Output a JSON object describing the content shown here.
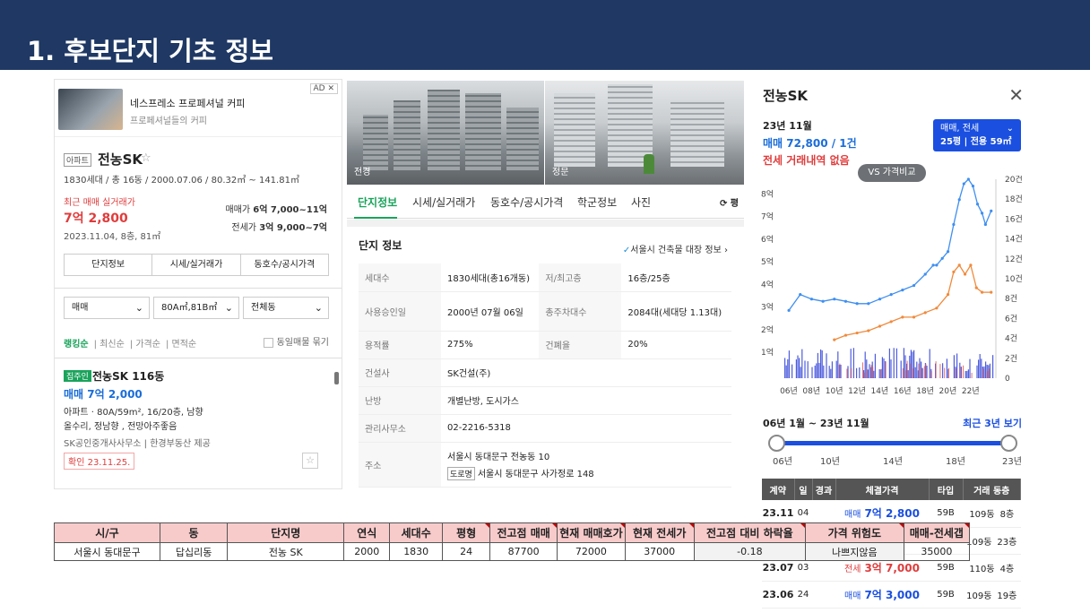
{
  "slide": {
    "title": "1. 후보단지 기초 정보"
  },
  "left_panel": {
    "ad": {
      "title": "네스프레소 프로페셔널 커피",
      "subtitle": "프로페셔널들의 커피",
      "badge": "AD ✕"
    },
    "apt": {
      "tag": "아파트",
      "name": "전농SK",
      "star": "☆",
      "info": "1830세대 / 총 16동 / 2000.07.06 / 80.32㎡ ~ 141.81㎡",
      "recent_label": "최근 매매 실거래가",
      "recent_price": "7억 2,800",
      "recent_date": "2023.11.04, 8층, 81㎡",
      "sale_label": "매매가",
      "sale_range": "6억 7,000~11억",
      "jeonse_label": "전세가",
      "jeonse_range": "3억 9,000~7억"
    },
    "tabs": [
      "단지정보",
      "시세/실거래가",
      "동호수/공시가격"
    ],
    "filters": [
      "매매",
      "80A㎡,81B㎡",
      "전체동"
    ],
    "sort": [
      "랭킹순",
      "최신순",
      "가격순",
      "면적순"
    ],
    "same_listing": "동일매물 묶기",
    "listing": {
      "badge": "집주인",
      "name": "전농SK 116동",
      "price": "매매 7억 2,000",
      "line1": "아파트 · 80A/59m², 16/20층, 남향",
      "line2": "올수리, 정남향 , 전망아주좋음",
      "line3": "SK공인중개사사무소 | 한경부동산 제공",
      "confirm": "확인 23.11.25."
    }
  },
  "middle_panel": {
    "photo_captions": [
      "전경",
      "정문"
    ],
    "tabs": [
      "단지정보",
      "시세/실거래가",
      "동호수/공시가격",
      "학군정보",
      "사진"
    ],
    "tab_more": "⟳ 평",
    "info_title": "단지 정보",
    "registry_link": "서울시 건축물 대장 정보",
    "rows": [
      {
        "k1": "세대수",
        "v1": "1830세대(총16개동)",
        "k2": "저/최고층",
        "v2": "16층/25층"
      },
      {
        "k1": "사용승인일",
        "v1": "2000년 07월 06일",
        "k2": "총주차대수",
        "v2": "2084대(세대당 1.13대)"
      },
      {
        "k1": "용적률",
        "v1": "275%",
        "k2": "건폐율",
        "v2": "20%"
      },
      {
        "k1": "건설사",
        "v1": "SK건설(주)"
      },
      {
        "k1": "난방",
        "v1": "개별난방, 도시가스"
      },
      {
        "k1": "관리사무소",
        "v1": "02-2216-5318"
      }
    ],
    "address": {
      "label": "주소",
      "jibun": "서울시 동대문구 전농동 10",
      "road_tag": "도로명",
      "road": "서울시 동대문구 사가정로 148"
    }
  },
  "right_panel": {
    "title": "전농SK",
    "close": "✕",
    "year_month": "23년 11월",
    "sale_price": "매매 72,800 / 1건",
    "no_jeonse": "전세 거래내역 없음",
    "select_line1": "매매, 전세",
    "select_line2": "25평 | 전용 59㎡",
    "vs_label": "VS 가격비교",
    "period": "06년 1월 ~ 23년 11월",
    "recent3": "최근 3년 보기",
    "slider_labels": [
      "06년",
      "10년",
      "14년",
      "18년",
      "23년"
    ],
    "table_headers": [
      "계약",
      "일",
      "경과",
      "체결가격",
      "타입",
      "거래 동층"
    ],
    "table_rows": [
      {
        "ym": "23.11",
        "day": "04",
        "kind": "매매",
        "price": "7억 2,800",
        "type": "59B",
        "dong": "109동",
        "floor": "8층",
        "k": "sp"
      },
      {
        "ym": "23.09",
        "day": "",
        "kind": "매매",
        "price": "",
        "type": "59B",
        "dong": "109동",
        "floor": "23층",
        "k": "sp"
      },
      {
        "ym": "23.07",
        "day": "03",
        "kind": "전세",
        "price": "3억 7,000",
        "type": "59B",
        "dong": "110동",
        "floor": "4층",
        "k": "jp"
      },
      {
        "ym": "23.06",
        "day": "24",
        "kind": "매매",
        "price": "7억 3,000",
        "type": "59B",
        "dong": "109동",
        "floor": "19층",
        "k": "sp"
      }
    ]
  },
  "chart_data": {
    "type": "line",
    "x_ticks": [
      "06년",
      "08년",
      "10년",
      "12년",
      "14년",
      "16년",
      "18년",
      "20년",
      "22년"
    ],
    "y_left_ticks": [
      "1억",
      "2억",
      "3억",
      "4억",
      "5억",
      "6억",
      "7억",
      "8억"
    ],
    "y_right_ticks": [
      "0",
      "2건",
      "4건",
      "6건",
      "8건",
      "10건",
      "12건",
      "14건",
      "16건",
      "18건",
      "20건"
    ],
    "ylim": [
      0,
      8.8
    ],
    "series": [
      {
        "color": "#3f8ff0",
        "x": [
          2006,
          2007,
          2008,
          2009,
          2010,
          2011,
          2012,
          2013,
          2014,
          2015,
          2016,
          2017,
          2018,
          2018.7,
          2019,
          2019.5,
          2020,
          2020.5,
          2021,
          2021.4,
          2021.8,
          2022.2,
          2022.6,
          2023,
          2023.3,
          2023.8
        ],
        "values": [
          3.0,
          3.7,
          3.5,
          3.4,
          3.5,
          3.4,
          3.3,
          3.3,
          3.5,
          3.7,
          3.9,
          4.1,
          4.6,
          5.0,
          5.0,
          5.3,
          5.6,
          6.8,
          7.9,
          8.6,
          8.8,
          8.5,
          7.7,
          7.3,
          6.8,
          7.4
        ]
      },
      {
        "color": "#f08a3c",
        "x": [
          2010,
          2011,
          2012,
          2013,
          2014,
          2015,
          2016,
          2017,
          2018,
          2019,
          2020,
          2020.5,
          2021,
          2021.5,
          2022,
          2022.5,
          2023,
          2023.8
        ],
        "values": [
          1.7,
          1.9,
          2.0,
          2.1,
          2.3,
          2.5,
          2.7,
          2.7,
          2.9,
          3.1,
          3.7,
          4.7,
          5.0,
          4.6,
          5.0,
          4.0,
          3.8,
          3.8
        ]
      }
    ]
  },
  "summary_table": {
    "headers": [
      "시/구",
      "동",
      "단지명",
      "연식",
      "세대수",
      "평형",
      "전고점 매매",
      "현재 매매호가",
      "현재 전세가",
      "전고점 대비 하락율",
      "가격 위험도",
      "매매-전세갭"
    ],
    "row": [
      "서울시 동대문구",
      "답십리동",
      "전농 SK",
      "2000",
      "1830",
      "24",
      "87700",
      "72000",
      "37000",
      "-0.18",
      "나쁘지않음",
      "35000"
    ]
  }
}
